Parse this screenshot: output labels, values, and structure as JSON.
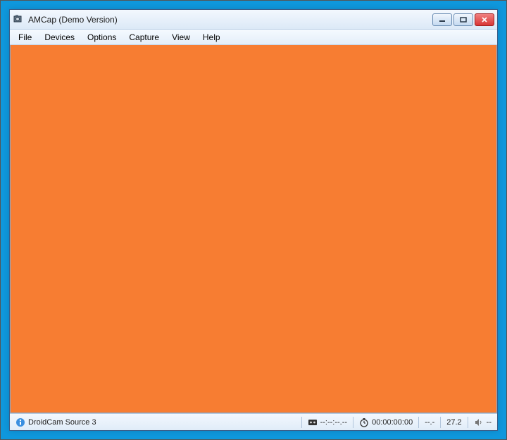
{
  "window": {
    "title": "AMCap (Demo Version)"
  },
  "menu": {
    "items": [
      "File",
      "Devices",
      "Options",
      "Capture",
      "View",
      "Help"
    ]
  },
  "content": {
    "background": "#f77d32"
  },
  "statusbar": {
    "device": "DroidCam Source 3",
    "tape_time": "--:--:--.--",
    "elapsed": "00:00:00:00",
    "rate": "--.-",
    "fps": "27.2",
    "audio": "--"
  }
}
